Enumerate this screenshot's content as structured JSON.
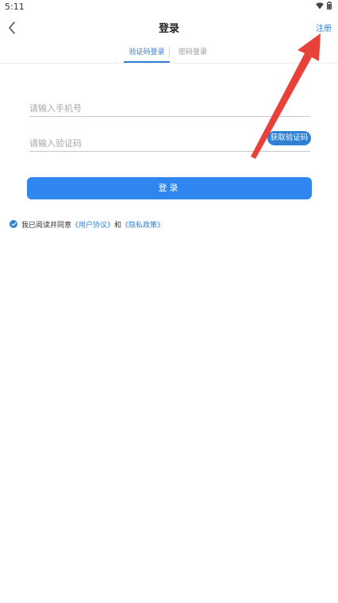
{
  "status_bar": {
    "time": "5:11"
  },
  "header": {
    "title": "登录",
    "register_label": "注册"
  },
  "tabs": [
    {
      "label": "验证码登录",
      "active": true
    },
    {
      "label": "密码登录",
      "active": false
    }
  ],
  "form": {
    "phone_placeholder": "请输入手机号",
    "code_placeholder": "请输入验证码",
    "get_code_label": "获取验证码",
    "login_label": "登录"
  },
  "agreement": {
    "prefix": "我已阅读并同意",
    "user_agreement": "《用户协议》",
    "and": "和",
    "privacy_policy": "《隐私政策》",
    "checked": true
  },
  "colors": {
    "accent": "#2f7fd4",
    "button": "#2f86ef",
    "annotation_arrow": "#e8413a"
  },
  "icons": {
    "back": "chevron-left-icon",
    "wifi": "wifi-icon",
    "battery": "battery-icon",
    "check": "check-circle-icon"
  }
}
